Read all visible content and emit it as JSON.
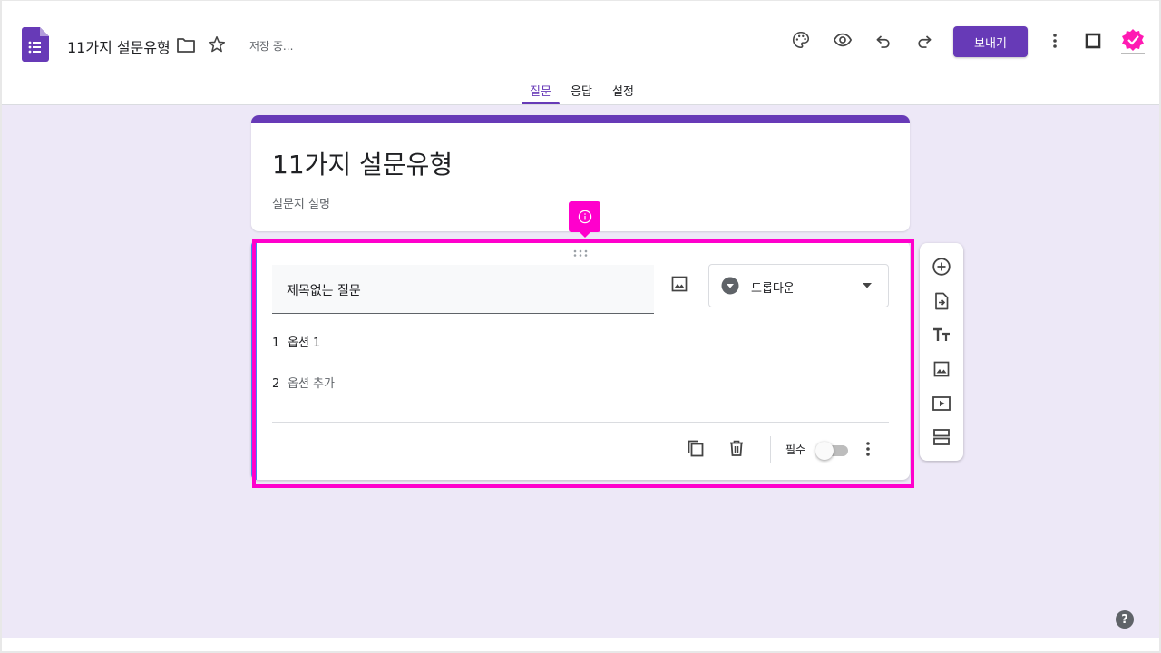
{
  "app": {
    "doc_title": "11가지 설문유형",
    "saving_status": "저장 중...",
    "send_label": "보내기"
  },
  "tabs": [
    {
      "label": "질문",
      "active": true
    },
    {
      "label": "응답",
      "active": false
    },
    {
      "label": "설정",
      "active": false
    }
  ],
  "form": {
    "title": "11가지 설문유형",
    "description": "설문지 설명"
  },
  "question": {
    "title": "제목없는 질문",
    "type": "드롭다운",
    "options": [
      {
        "num": "1",
        "label": "옵션 1"
      }
    ],
    "add_option": {
      "num": "2",
      "label": "옵션 추가"
    },
    "required_label": "필수",
    "required": false
  },
  "help_label": "?",
  "colors": {
    "brand": "#673ab7",
    "background": "#ede8f7",
    "highlight": "#ff00cc",
    "accent_bar": "#4285f4"
  },
  "icons": {
    "header": [
      "folder-icon",
      "star-icon",
      "palette-icon",
      "eye-icon",
      "undo-icon",
      "redo-icon",
      "more-vert-icon",
      "square-icon"
    ],
    "side_tools": [
      "add-question-icon",
      "import-questions-icon",
      "title-text-icon",
      "image-icon",
      "video-icon",
      "section-icon"
    ]
  }
}
